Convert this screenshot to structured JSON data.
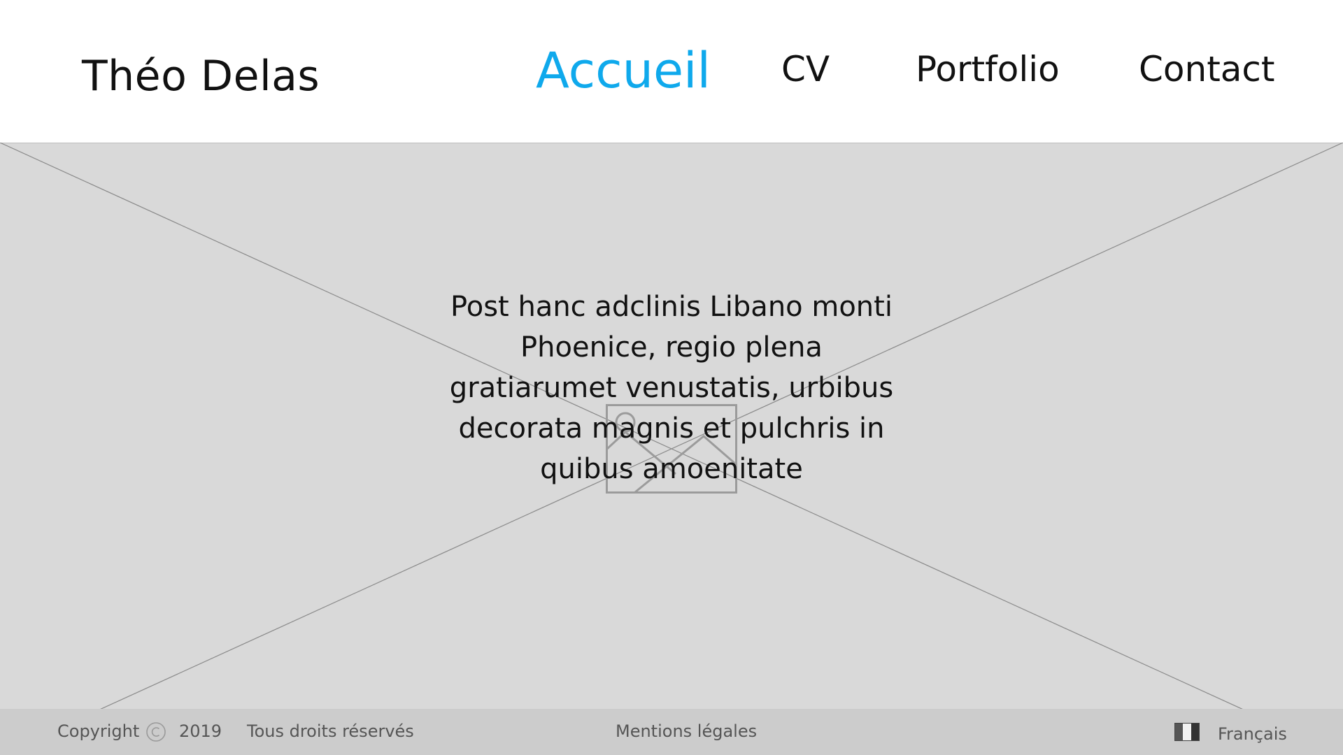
{
  "header": {
    "brand": "Théo Delas",
    "nav": [
      {
        "label": "Accueil",
        "active": true
      },
      {
        "label": "CV",
        "active": false
      },
      {
        "label": "Portfolio",
        "active": false
      },
      {
        "label": "Contact",
        "active": false
      }
    ]
  },
  "hero": {
    "text": "Post hanc adclinis Libano monti Phoenice, regio plena gratiarumet venustatis, urbibus decorata magnis et pulchris in quibus amoenitate",
    "placeholder_icon": "image-placeholder-icon"
  },
  "footer": {
    "copyright_label": "Copyright",
    "copyright_icon": "copyright-icon",
    "year": "2019",
    "rights": "Tous droits réservés",
    "legal": "Mentions légales",
    "language_flag_icon": "french-flag-icon",
    "language": "Français"
  },
  "colors": {
    "accent": "#0fa9ec",
    "hero_bg": "#d9d9d9",
    "footer_bg": "#cccccc",
    "text": "#111111",
    "footer_text": "#555555"
  }
}
